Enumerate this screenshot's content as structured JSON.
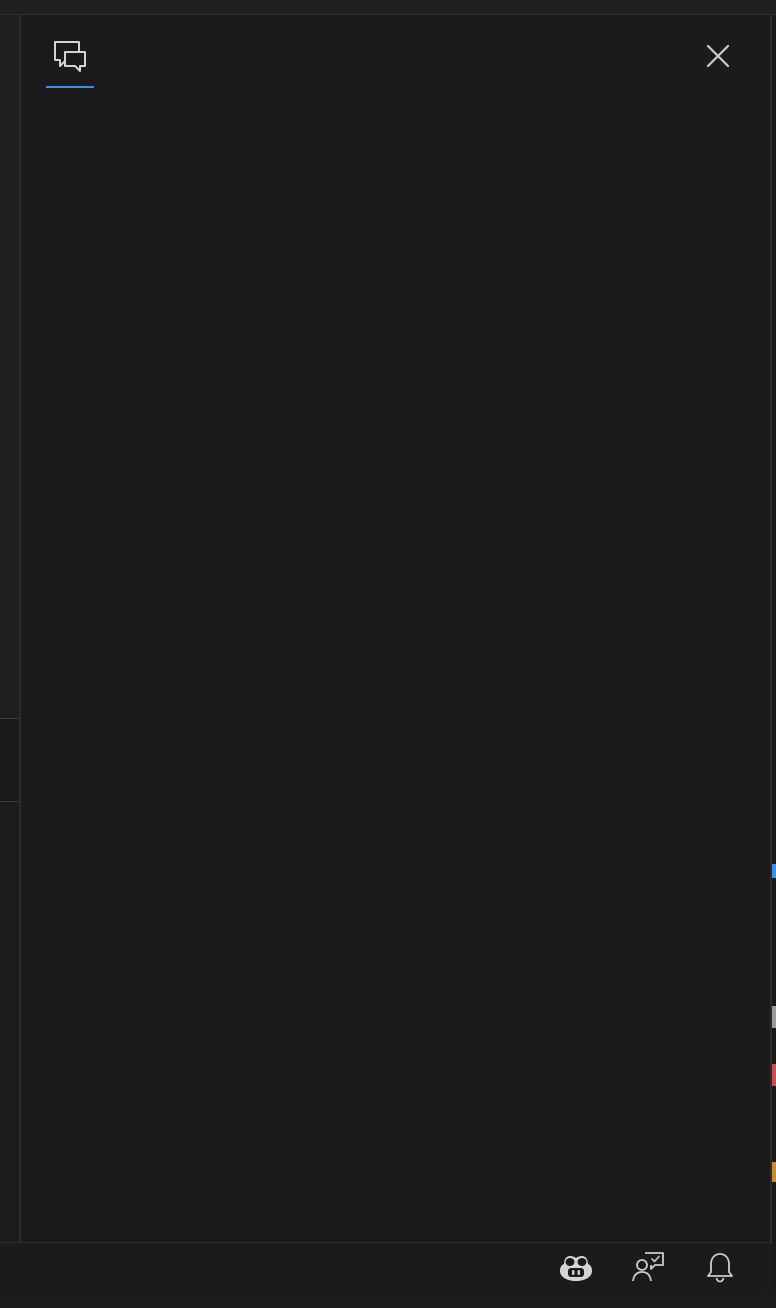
{
  "window": {
    "background": "#181818",
    "accent": "#3b8eea"
  },
  "side_panel": {
    "tabs": [
      {
        "icon": "chat-icon",
        "active": true
      }
    ],
    "close_icon": "close-icon"
  },
  "status_bar": {
    "items": [
      {
        "icon": "copilot-icon"
      },
      {
        "icon": "accounts-feedback-icon"
      },
      {
        "icon": "bell-icon"
      }
    ]
  },
  "edge_marks": {
    "colors": [
      "#3b8eea",
      "#9a9a9a",
      "#c94b4b",
      "#c98a3b"
    ]
  }
}
